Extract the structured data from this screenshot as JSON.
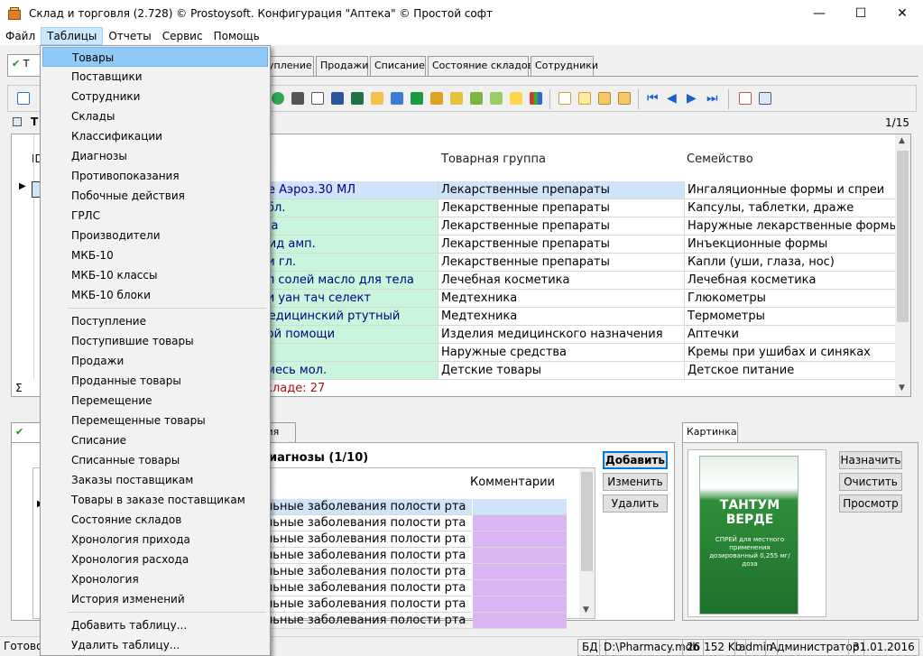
{
  "window": {
    "title": "Склад и торговля (2.728) © Prostoysoft. Конфигурация \"Аптека\" © Простой софт",
    "minimize": "—",
    "maximize": "☐",
    "close": "✕"
  },
  "menubar": [
    "Файл",
    "Таблицы",
    "Отчеты",
    "Сервис",
    "Помощь"
  ],
  "tabs": [
    "Поступление",
    "Продажи",
    "Списание",
    "Состояние складов",
    "Сотрудники"
  ],
  "tab_visible": [
    "упление",
    "Продажи",
    "Списание",
    "Состояние складов",
    "Сотрудники"
  ],
  "first_tab_prefix": "Т",
  "check": "✔",
  "grid": {
    "label_prefix": "Т",
    "pager": "1/15",
    "id_col": "ID",
    "sigma": "Σ",
    "columns": [
      "Товарная группа",
      "Семейство"
    ],
    "rows": [
      {
        "name": "де Аэроз.30 МЛ",
        "group": "Лекарственные препараты",
        "family": "Ингаляционные формы и спреи",
        "selected": true
      },
      {
        "name": "абл.",
        "group": "Лекарственные препараты",
        "family": "Капсулы, таблетки, драже"
      },
      {
        "name": "-ка",
        "group": "Лекарственные препараты",
        "family": "Наружные лекарственные формы"
      },
      {
        "name": "мид амп.",
        "group": "Лекарственные препараты",
        "family": "Инъекционные формы"
      },
      {
        "name": "ли гл.",
        "group": "Лекарственные препараты",
        "family": "Капли (уши, глаза, нос)"
      },
      {
        "name": "ал солей масло  для тела",
        "group": "Лечебная косметика",
        "family": "Лечебная косметика"
      },
      {
        "name": "ки уан тач селект",
        "group": "Медтехника",
        "family": "Глюкометры"
      },
      {
        "name": "медицинский ртутный",
        "group": "Медтехника",
        "family": "Термометры"
      },
      {
        "name": "вой помощи",
        "group": "Изделия медицинского назначения",
        "family": "Аптечки"
      },
      {
        "name": "",
        "group": "Наружные средства",
        "family": "Кремы при ушибах и синяках"
      },
      {
        "name": "смесь мол.",
        "group": "Детские товары",
        "family": "Детское питание"
      }
    ],
    "footer": "складе: 27"
  },
  "lower": {
    "tab_fragment": "вия",
    "title": "иагнозы (1/10)",
    "col_comment": "Комментарии",
    "rows": [
      "льные заболевания полости рта",
      "льные заболевания полости рта",
      "льные заболевания полости рта",
      "льные заболевания полости рта",
      "льные заболевания полости рта",
      "льные заболевания полости рта",
      "льные заболевания полости рта",
      "льные заболевания полости рта"
    ],
    "buttons": [
      "Добавить",
      "Изменить",
      "Удалить"
    ]
  },
  "picture": {
    "tab": "Картинка",
    "buttons": [
      "Назначить",
      "Очистить",
      "Просмотр"
    ],
    "product_brand": "ТАНТУМ ВЕРДЕ",
    "product_text": "СПРЕЙ для местного применения дозированный 0,255 мг/доза"
  },
  "dropdown": {
    "group1": [
      "Товары",
      "Поставщики",
      "Сотрудники",
      "Склады",
      "Классификации",
      "Диагнозы",
      "Противопоказания",
      "Побочные действия",
      "ГРЛС",
      "Производители",
      "МКБ-10",
      "МКБ-10 классы",
      "МКБ-10 блоки"
    ],
    "group2": [
      "Поступление",
      "Поступившие товары",
      "Продажи",
      "Проданные товары",
      "Перемещение",
      "Перемещенные товары",
      "Списание",
      "Списанные товары",
      "Заказы поставщикам",
      "Товары в заказе поставщикам",
      "Состояние складов",
      "Хронология прихода",
      "Хронология расхода",
      "Хронология",
      "История изменений"
    ],
    "group3": [
      "Добавить таблицу...",
      "Удалить таблицу..."
    ]
  },
  "status": {
    "ready": "Готово",
    "db_label": "БД:",
    "db_path": "D:\\Pharmacy.mdb",
    "db_size": "26 152 Kb",
    "user": "admin",
    "role": "Администратор",
    "date": "31.01.2016"
  },
  "colors": {
    "name_cell": "#c8f5dc",
    "selected_cell": "#cfe3f9",
    "diag_cell": "#d9b6f2",
    "menu_highlight": "#91c9f7",
    "name_text": "#00007f"
  }
}
